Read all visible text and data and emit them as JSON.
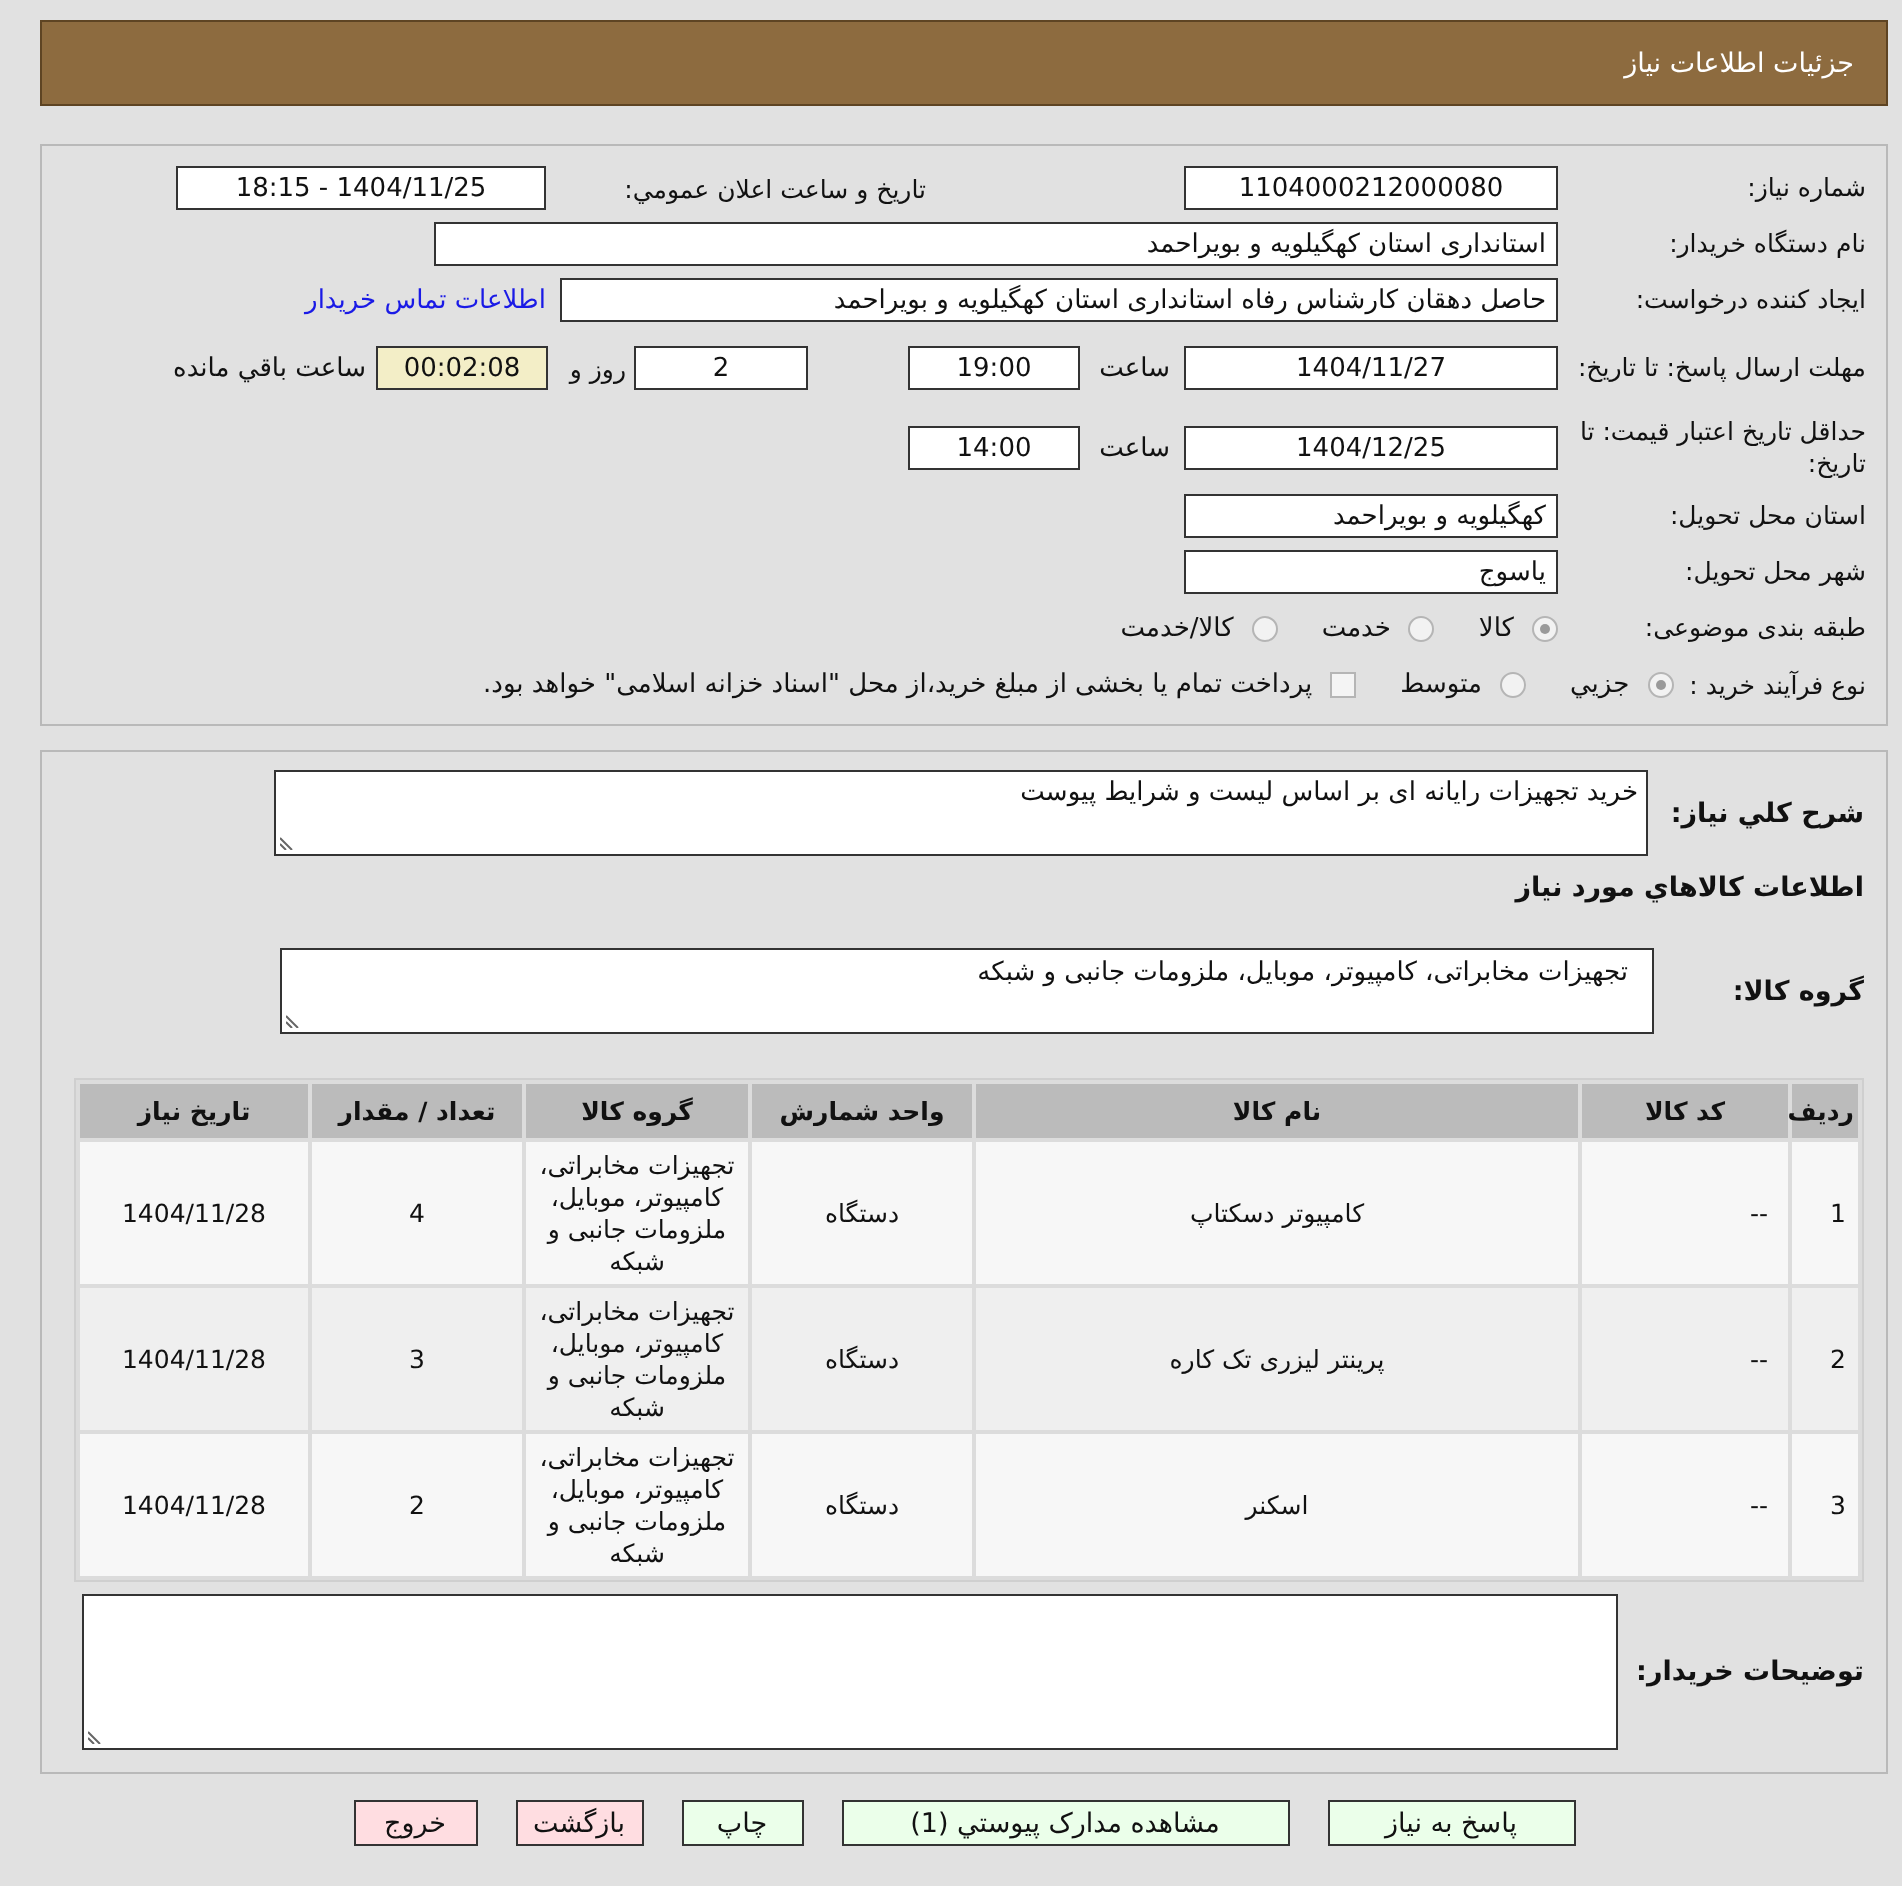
{
  "header": {
    "title": "جزئیات اطلاعات نیاز"
  },
  "details": {
    "need_number": {
      "label": "شماره نیاز:",
      "value": "1104000212000080"
    },
    "announce_datetime": {
      "label": "تاریخ و ساعت اعلان عمومي:",
      "value": "1404/11/25 - 18:15"
    },
    "buyer_org": {
      "label": "نام دستگاه خریدار:",
      "value": "استانداری استان کهگیلویه و بویراحمد"
    },
    "requester": {
      "label": "ایجاد کننده درخواست:",
      "value": "حاصل دهقان کارشناس رفاه استانداری استان کهگیلویه و بویراحمد",
      "link": "اطلاعات تماس خریدار"
    },
    "reply_deadline": {
      "label": "مهلت ارسال پاسخ: تا تاریخ:",
      "date": "1404/11/27",
      "time_label": "ساعت",
      "time": "19:00",
      "days": "2",
      "days_label": "روز و",
      "remaining": "00:02:08",
      "remaining_label": "ساعت باقي مانده"
    },
    "price_validity": {
      "label": "حداقل تاریخ اعتبار قیمت: تا تاریخ:",
      "date": "1404/12/25",
      "time_label": "ساعت",
      "time": "14:00"
    },
    "delivery_province": {
      "label": "استان محل تحویل:",
      "value": "کهگیلویه و بویراحمد"
    },
    "delivery_city": {
      "label": "شهر محل تحویل:",
      "value": "یاسوج"
    },
    "category": {
      "label": "طبقه بندی موضوعی:",
      "options": [
        {
          "label": "کالا",
          "selected": true
        },
        {
          "label": "خدمت",
          "selected": false
        },
        {
          "label": "کالا/خدمت",
          "selected": false
        }
      ]
    },
    "purchase_type": {
      "label": "نوع فرآیند خرید :",
      "options": [
        {
          "label": "جزيي",
          "selected": true
        },
        {
          "label": "متوسط",
          "selected": false
        }
      ],
      "payment_note": {
        "label": "پرداخت تمام یا بخشی از مبلغ خرید،از محل \"اسناد خزانه اسلامی\" خواهد بود.",
        "checked": false
      }
    }
  },
  "need": {
    "description": {
      "label": "شرح کلي نیاز:",
      "value": "خرید تجهیزات رایانه ای بر اساس لیست و شرایط پیوست"
    },
    "goods_title": "اطلاعات کالاهاي مورد نیاز",
    "goods_group": {
      "label": "گروه کالا:",
      "value": "تجهیزات مخابراتی، کامپیوتر، موبایل، ملزومات جانبی و شبکه"
    }
  },
  "table": {
    "columns": [
      "ردیف",
      "کد کالا",
      "نام کالا",
      "واحد شمارش",
      "گروه کالا",
      "تعداد / مقدار",
      "تاریخ نیاز"
    ],
    "rows": [
      {
        "cells": [
          "1",
          "--",
          "کامپیوتر دسکتاپ",
          "دستگاه",
          "تجهیزات مخابراتی، کامپیوتر، موبایل، ملزومات جانبی و شبکه",
          "4",
          "1404/11/28"
        ]
      },
      {
        "cells": [
          "2",
          "--",
          "پرینتر لیزری تک کاره",
          "دستگاه",
          "تجهیزات مخابراتی، کامپیوتر، موبایل، ملزومات جانبی و شبکه",
          "3",
          "1404/11/28"
        ]
      },
      {
        "cells": [
          "3",
          "--",
          "اسکنر",
          "دستگاه",
          "تجهیزات مخابراتی، کامپیوتر، موبایل، ملزومات جانبی و شبکه",
          "2",
          "1404/11/28"
        ]
      }
    ]
  },
  "buyer_notes": {
    "label": "توضیحات خریدار:"
  },
  "buttons": [
    {
      "label": "پاسخ به نیاز",
      "kind": "action"
    },
    {
      "label": "مشاهده مدارک پیوستي (1)",
      "kind": "action"
    },
    {
      "label": "چاپ",
      "kind": "action"
    },
    {
      "label": "بازگشت",
      "kind": "exit"
    },
    {
      "label": "خروج",
      "kind": "exit"
    }
  ]
}
